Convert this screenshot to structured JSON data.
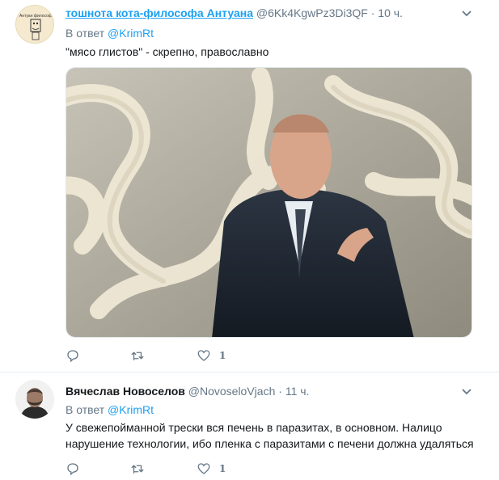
{
  "tweets": [
    {
      "name": "тошнота кота-философа Антуана",
      "handle": "@6Kk4KgwPz3Di3QF",
      "time": "10 ч.",
      "reply_prefix": "В ответ",
      "reply_to": "@KrimRt",
      "text": "\"мясо глистов\" - скрепно, православно",
      "like_count": "1",
      "avatar_text": "Антуан философ"
    },
    {
      "name": "Вячеслав Новоселов",
      "handle": "@NovoseloVjach",
      "time": "11 ч.",
      "reply_prefix": "В ответ",
      "reply_to": "@KrimRt",
      "text": "У свежепойманной трески вся печень в паразитах, в основном. Налицо нарушение технологии, ибо пленка с паразитами с печени должна удаляться",
      "like_count": "1"
    }
  ],
  "icons": {
    "reply": "reply-icon",
    "retweet": "retweet-icon",
    "like": "heart-icon",
    "menu": "chevron-down-icon"
  },
  "colors": {
    "link": "#1da1f2",
    "secondary": "#657786",
    "text": "#14171a"
  },
  "separator": "·"
}
